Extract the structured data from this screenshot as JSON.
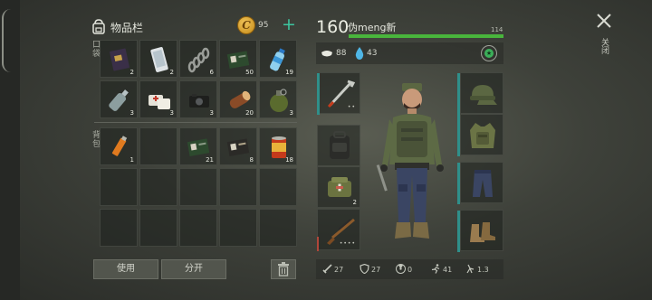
{
  "inventory": {
    "title": "物品栏",
    "coins": "95",
    "add_label": "+",
    "pockets_label": "口袋",
    "backpack_label": "背包",
    "pocket_slots": [
      {
        "item": "passport",
        "count": "2"
      },
      {
        "item": "smartphone",
        "count": "2"
      },
      {
        "item": "spring",
        "count": "6"
      },
      {
        "item": "green-card",
        "count": "50"
      },
      {
        "item": "water-bottle",
        "count": "19"
      },
      {
        "item": "empty-bottle",
        "count": "3"
      },
      {
        "item": "bandage",
        "count": "3"
      },
      {
        "item": "camera",
        "count": "3"
      },
      {
        "item": "log",
        "count": "20"
      },
      {
        "item": "grenade",
        "count": "3"
      }
    ],
    "backpack_slots": [
      {
        "item": "usb-flashlight",
        "count": "1"
      },
      {
        "item": "",
        "count": ""
      },
      {
        "item": "green-card",
        "count": "21"
      },
      {
        "item": "dark-card",
        "count": "8"
      },
      {
        "item": "canned-food",
        "count": "18"
      }
    ]
  },
  "buttons": {
    "use": "使用",
    "split": "分开"
  },
  "character": {
    "level": "160",
    "name": "伪meng新",
    "hp": "114",
    "hp_fraction": 1.0,
    "food": "88",
    "water": "43",
    "equipment_count": "2"
  },
  "stats": {
    "attack": "27",
    "defense": "27",
    "radiation": "0",
    "speed": "41",
    "stealth": "1.3"
  },
  "close_label": "关闭",
  "colors": {
    "accent": "#3dc6a0",
    "hp": "#49b53c",
    "edge": "#2f8f8a",
    "coin": "#e0a92c"
  }
}
